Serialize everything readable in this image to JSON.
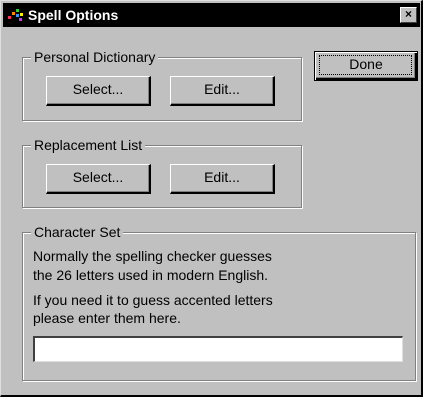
{
  "window": {
    "title": "Spell Options",
    "close_label": "×"
  },
  "personal_dictionary": {
    "legend": "Personal Dictionary",
    "select_label": "Select...",
    "edit_label": "Edit..."
  },
  "done_label": "Done",
  "replacement_list": {
    "legend": "Replacement List",
    "select_label": "Select...",
    "edit_label": "Edit..."
  },
  "character_set": {
    "legend": "Character Set",
    "line1": "Normally the spelling checker guesses",
    "line2": "the 26 letters used in modern English.",
    "line3": "If you need it to guess accented letters",
    "line4": "please enter them here.",
    "input_value": "",
    "input_placeholder": ""
  },
  "icons": {
    "app": "spell-app-icon",
    "close": "close-icon"
  },
  "colors": {
    "dialog_face": "#c0c0c0",
    "titlebar": "#000000",
    "title_text": "#ffffff"
  }
}
